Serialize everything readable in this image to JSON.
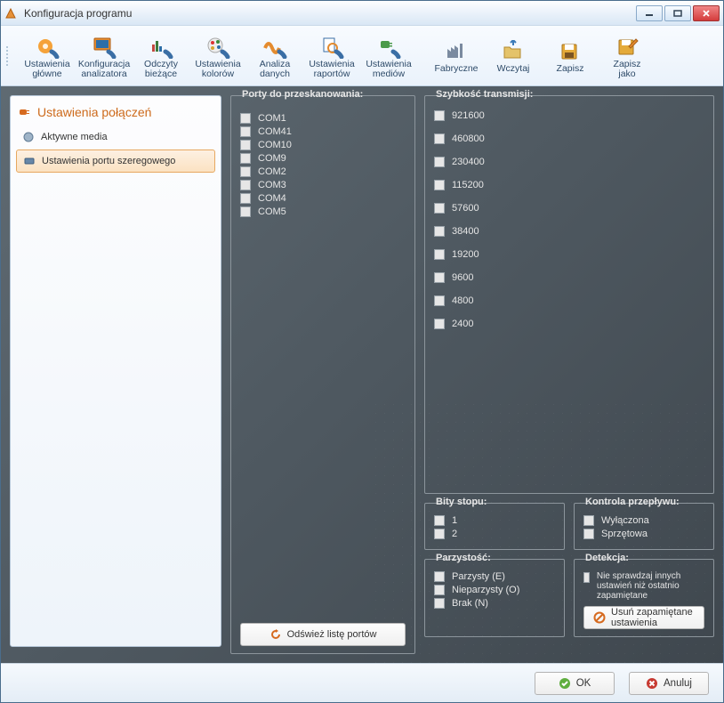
{
  "window": {
    "title": "Konfiguracja programu"
  },
  "toolbar": {
    "items": [
      {
        "label": "Ustawienia\ngłówne"
      },
      {
        "label": "Konfiguracja\nanalizatora"
      },
      {
        "label": "Odczyty\nbieżące"
      },
      {
        "label": "Ustawienia\nkolorów"
      },
      {
        "label": "Analiza\ndanych"
      },
      {
        "label": "Ustawienia\nraportów"
      },
      {
        "label": "Ustawienia\nmediów"
      },
      {
        "label": "Fabryczne"
      },
      {
        "label": "Wczytaj"
      },
      {
        "label": "Zapisz"
      },
      {
        "label": "Zapisz\njako"
      }
    ]
  },
  "sidebar": {
    "title": "Ustawienia połączeń",
    "items": [
      {
        "label": "Aktywne media"
      },
      {
        "label": "Ustawienia portu szeregowego"
      }
    ],
    "selected": 1
  },
  "scan": {
    "legend": "Porty do przeskanowania:",
    "ports": [
      "COM1",
      "COM41",
      "COM10",
      "COM9",
      "COM2",
      "COM3",
      "COM4",
      "COM5"
    ],
    "refresh_label": "Odśwież listę portów"
  },
  "speed": {
    "legend": "Szybkość transmisji:",
    "values": [
      "921600",
      "460800",
      "230400",
      "115200",
      "57600",
      "38400",
      "19200",
      "9600",
      "4800",
      "2400"
    ]
  },
  "stopbits": {
    "legend": "Bity stopu:",
    "values": [
      "1",
      "2"
    ]
  },
  "flow": {
    "legend": "Kontrola przepływu:",
    "values": [
      "Wyłączona",
      "Sprzętowa"
    ]
  },
  "parity": {
    "legend": "Parzystość:",
    "values": [
      "Parzysty (E)",
      "Nieparzysty (O)",
      "Brak (N)"
    ]
  },
  "detect": {
    "legend": "Detekcja:",
    "check_label": "Nie sprawdzaj innych ustawień niż ostatnio zapamiętane",
    "clear_label": "Usuń zapamiętane ustawienia"
  },
  "buttons": {
    "ok": "OK",
    "cancel": "Anuluj"
  }
}
